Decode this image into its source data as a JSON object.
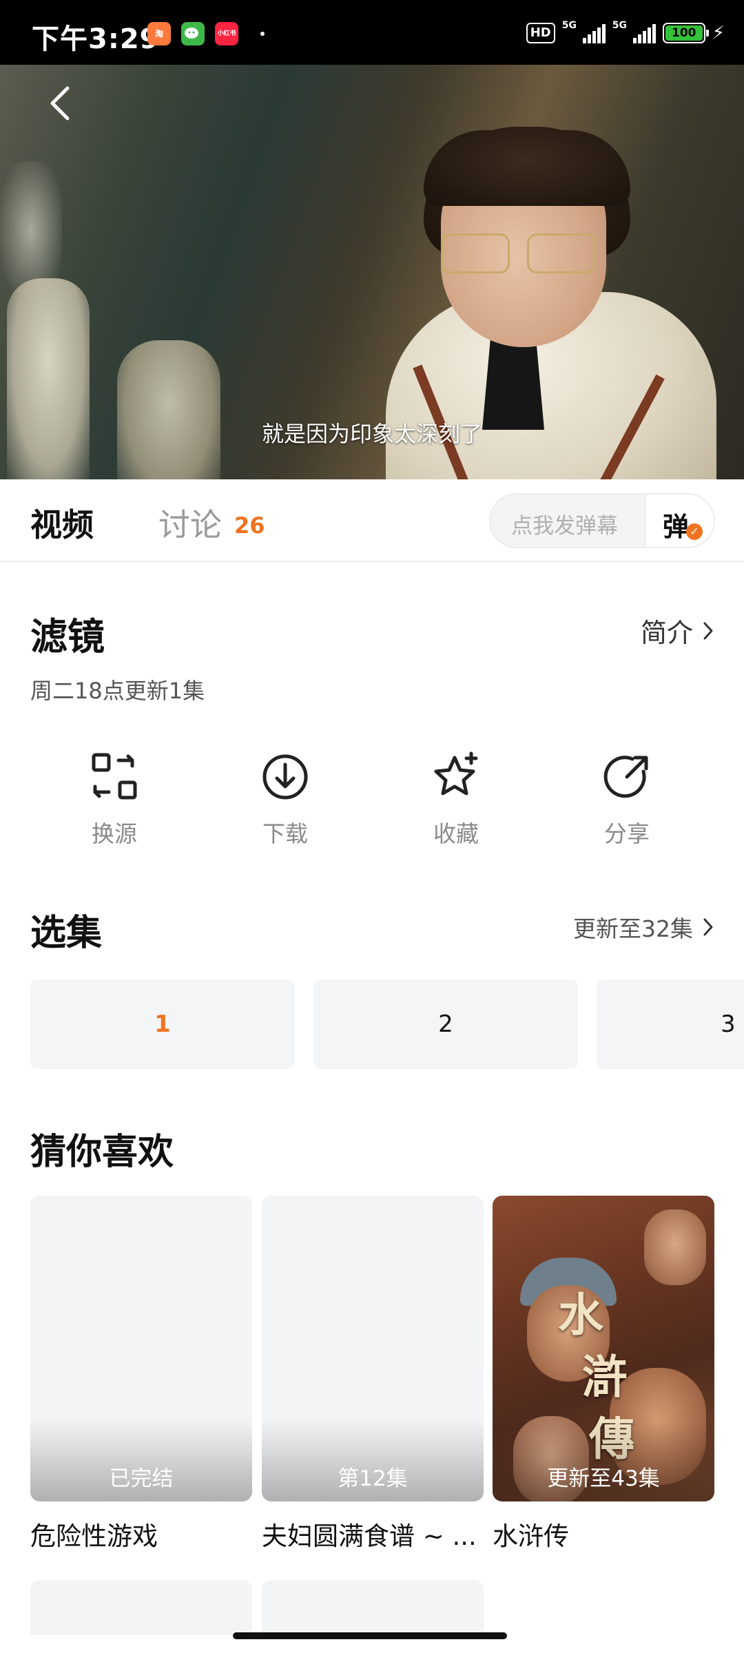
{
  "status_bar": {
    "time": "下午3:29",
    "apps": [
      "taobao-icon",
      "wechat-icon",
      "rednote-icon"
    ],
    "rednote_label": "小红书",
    "network": "5G",
    "hd_label": "HD",
    "battery": "100"
  },
  "player": {
    "subtitle": "就是因为印象太深刻了"
  },
  "tabs": {
    "video_label": "视频",
    "discuss_label": "讨论",
    "discuss_count": "26",
    "danmaku_placeholder": "点我发弹幕",
    "danmaku_button": "弹"
  },
  "show": {
    "title": "滤镜",
    "intro_label": "简介",
    "update_info": "周二18点更新1集"
  },
  "actions": [
    {
      "label": "换源",
      "icon": "switch-source-icon"
    },
    {
      "label": "下载",
      "icon": "download-icon"
    },
    {
      "label": "收藏",
      "icon": "favorite-star-icon"
    },
    {
      "label": "分享",
      "icon": "share-icon"
    }
  ],
  "episodes": {
    "title": "选集",
    "more_label": "更新至32集",
    "items": [
      "1",
      "2",
      "3"
    ],
    "active_index": 0
  },
  "recommend": {
    "title": "猜你喜欢",
    "items": [
      {
        "name": "危险性游戏",
        "badge": "已完结"
      },
      {
        "name": "夫妇圆满食谱 ~ ...",
        "badge": "第12集"
      },
      {
        "name": "水浒传",
        "badge": "更新至43集",
        "poster_text": [
          "水",
          "滸",
          "傳"
        ]
      }
    ]
  },
  "colors": {
    "accent": "#f0731f",
    "text_primary": "#111111",
    "text_muted": "#8a8a8a",
    "card_bg": "#f4f5f6"
  }
}
